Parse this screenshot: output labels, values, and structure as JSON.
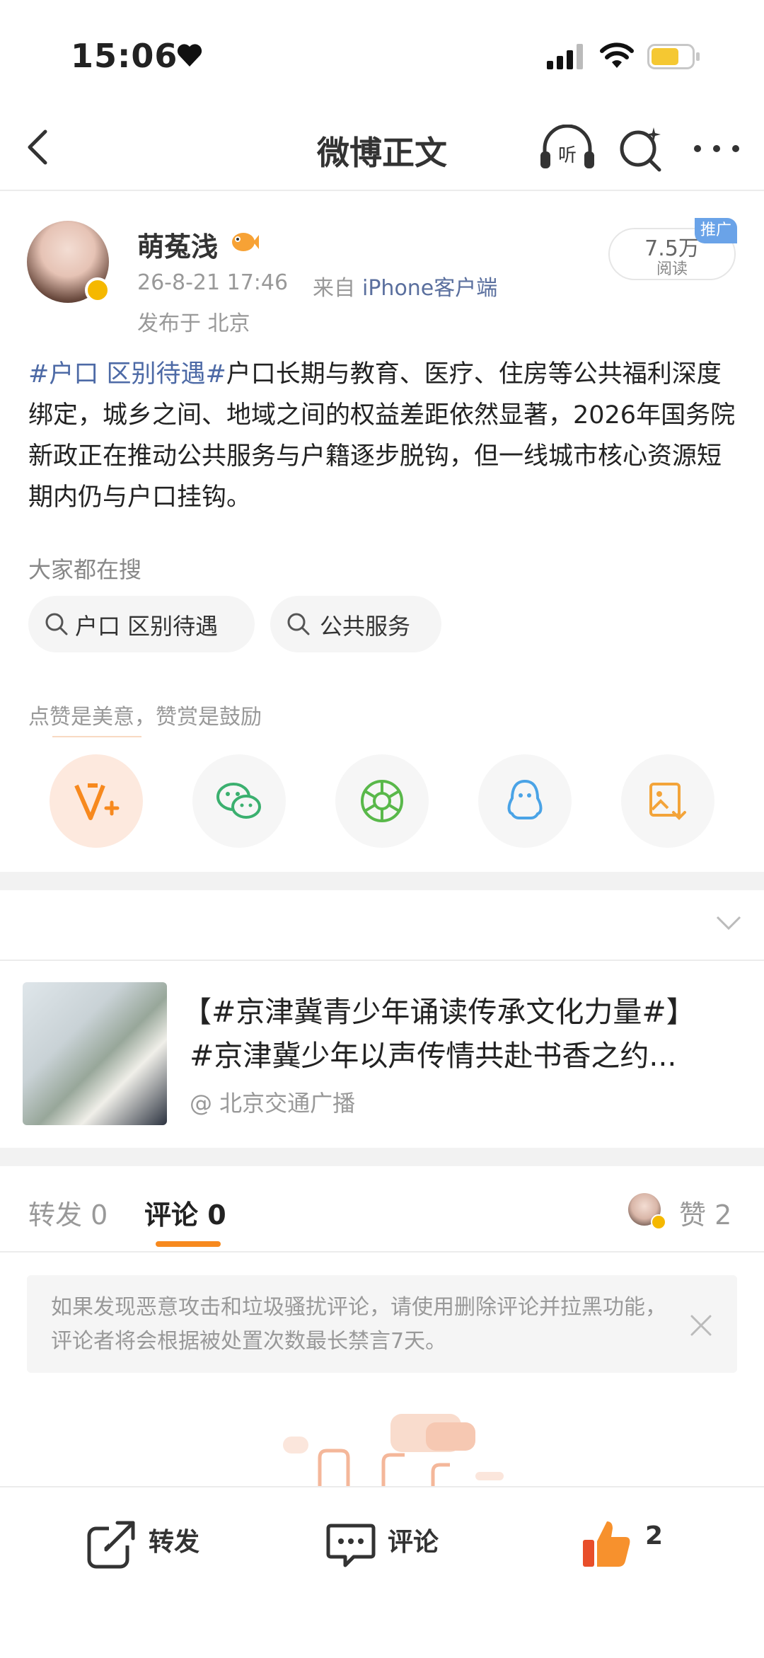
{
  "status_bar": {
    "time": "15:06"
  },
  "nav": {
    "title": "微博正文"
  },
  "post": {
    "author": "萌菟浅",
    "time": "26-8-21 17:46",
    "source_prefix": "来自",
    "source_client": "iPhone客户端",
    "location": "发布于 北京",
    "read_count": "7.5万",
    "read_label": "阅读",
    "promo_tag": "推广",
    "hashtag": "#户口 区别待遇#",
    "text": "户口长期与教育、医疗、住房等公共福利深度绑定，城乡之间、地域之间的权益差距依然显著，2026年国务院新政正在推动公共服务与户籍逐步脱钩，但一线城市核心资源短期内仍与户口挂钩。"
  },
  "search": {
    "title": "大家都在搜",
    "chips": [
      "户口 区别待遇",
      "公共服务"
    ]
  },
  "reward": {
    "label": "点赞是美意，赞赏是鼓励",
    "share_icons": [
      "reward-v-icon",
      "wechat-icon",
      "moments-icon",
      "qq-icon",
      "save-image-icon"
    ]
  },
  "card": {
    "title_line1": "【#京津冀青少年诵读传承文化力量#】",
    "title_line2": "#京津冀少年以声传情共赴书香之约...",
    "source": "@ 北京交通广播"
  },
  "tabs": {
    "repost": "转发 0",
    "comment": "评论 0",
    "like": "赞 2"
  },
  "notice": {
    "text": "如果发现恶意攻击和垃圾骚扰评论，请使用删除评论并拉黑功能，评论者将会根据被处置次数最长禁言7天。"
  },
  "bottom_bar": {
    "repost": "转发",
    "comment": "评论",
    "like_count": "2"
  },
  "colors": {
    "accent": "#f7891e",
    "link": "#4d6aa6",
    "battery": "#f5c832"
  }
}
